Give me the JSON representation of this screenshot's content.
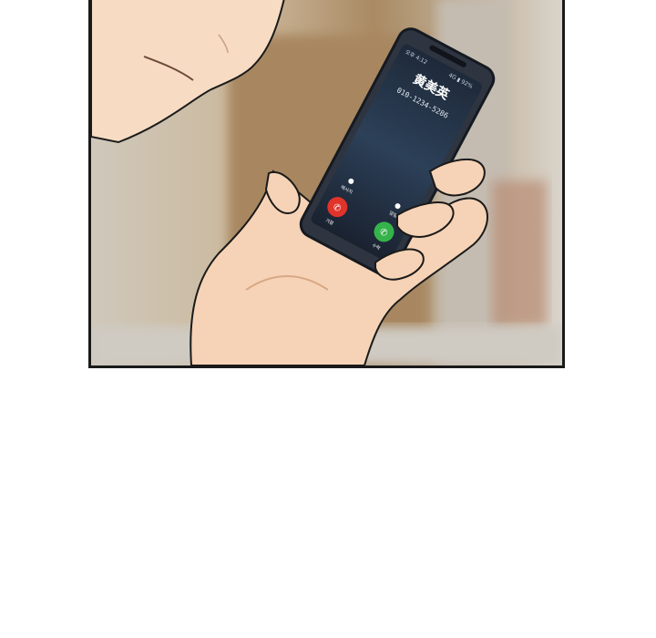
{
  "scene": {
    "phone": {
      "status_time": "오후 4:12",
      "status_right": "4G ▮ 92%",
      "caller_name": "黄美英",
      "caller_number": "010-1234-5286",
      "option_left_label": "메시지",
      "option_right_label": "알림",
      "decline_label": "거절",
      "accept_label": "수락"
    },
    "colors": {
      "skin": "#f6d3b6",
      "skin_shadow": "#e9b996",
      "background_wall": "#d7d0c3",
      "background_wood": "#a5835c",
      "phone_body": "#2f3540",
      "screen": "#223046",
      "decline": "#e0342a",
      "accept": "#35b34a"
    }
  }
}
